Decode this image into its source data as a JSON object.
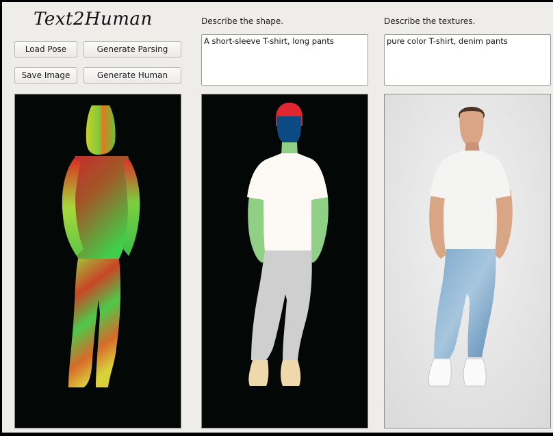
{
  "app": {
    "title": "Text2Human"
  },
  "buttons": {
    "load_pose": "Load Pose",
    "generate_parsing": "Generate Parsing",
    "save_image": "Save Image",
    "generate_human": "Generate Human"
  },
  "shape": {
    "label": "Describe the shape.",
    "value": "A short-sleeve T-shirt, long pants"
  },
  "texture": {
    "label": "Describe the textures.",
    "value": "pure color T-shirt, denim pants"
  },
  "colors": {
    "parsing_hair": "#e0262e",
    "parsing_face": "#0b4a82",
    "parsing_skin": "#8fcf86",
    "parsing_top": "#fdfaf6",
    "parsing_pants": "#cfcfcf",
    "parsing_shoes": "#f0d8ad"
  }
}
